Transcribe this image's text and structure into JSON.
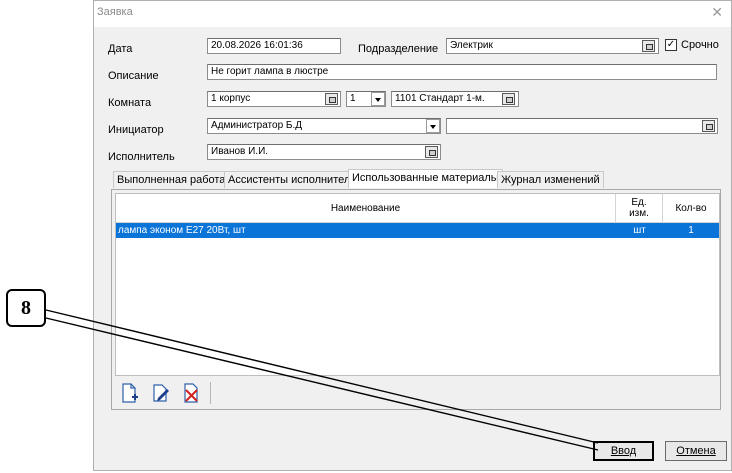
{
  "window": {
    "title": "Заявка",
    "close_glyph": "✕"
  },
  "form": {
    "date_label": "Дата",
    "date_value": "20.08.2026 16:01:36",
    "division_label": "Подразделение",
    "division_value": "Электрик",
    "urgent_label": "Срочно",
    "urgent_checked": true,
    "description_label": "Описание",
    "description_value": "Не горит лампа в люстре",
    "room_label": "Комната",
    "room_building": "1 корпус",
    "room_floor": "1",
    "room_value": "1101  Стандарт 1-м.",
    "initiator_label": "Инициатор",
    "initiator_value": "Администратор Б.Д",
    "initiator_extra": "",
    "executor_label": "Исполнитель",
    "executor_value": "Иванов И.И."
  },
  "tabs": [
    {
      "label": "Выполненная работа"
    },
    {
      "label": "Ассистенты исполнителя"
    },
    {
      "label": "Использованные материалы",
      "active": true
    },
    {
      "label": "Журнал изменений"
    }
  ],
  "table": {
    "headers": {
      "name": "Наименование",
      "unit": "Ед.\nизм.",
      "qty": "Кол-во"
    },
    "rows": [
      {
        "name": "лампа эконом Е27 20Вт, шт",
        "unit": "шт",
        "qty": "1",
        "selected": true
      }
    ]
  },
  "toolbar": {
    "icons": [
      "add-document-icon",
      "edit-pencil-icon",
      "delete-document-icon"
    ]
  },
  "buttons": {
    "ok": "Ввод",
    "cancel": "Отмена"
  },
  "callout": {
    "number": "8"
  },
  "colors": {
    "selection": "#0a74d9"
  }
}
